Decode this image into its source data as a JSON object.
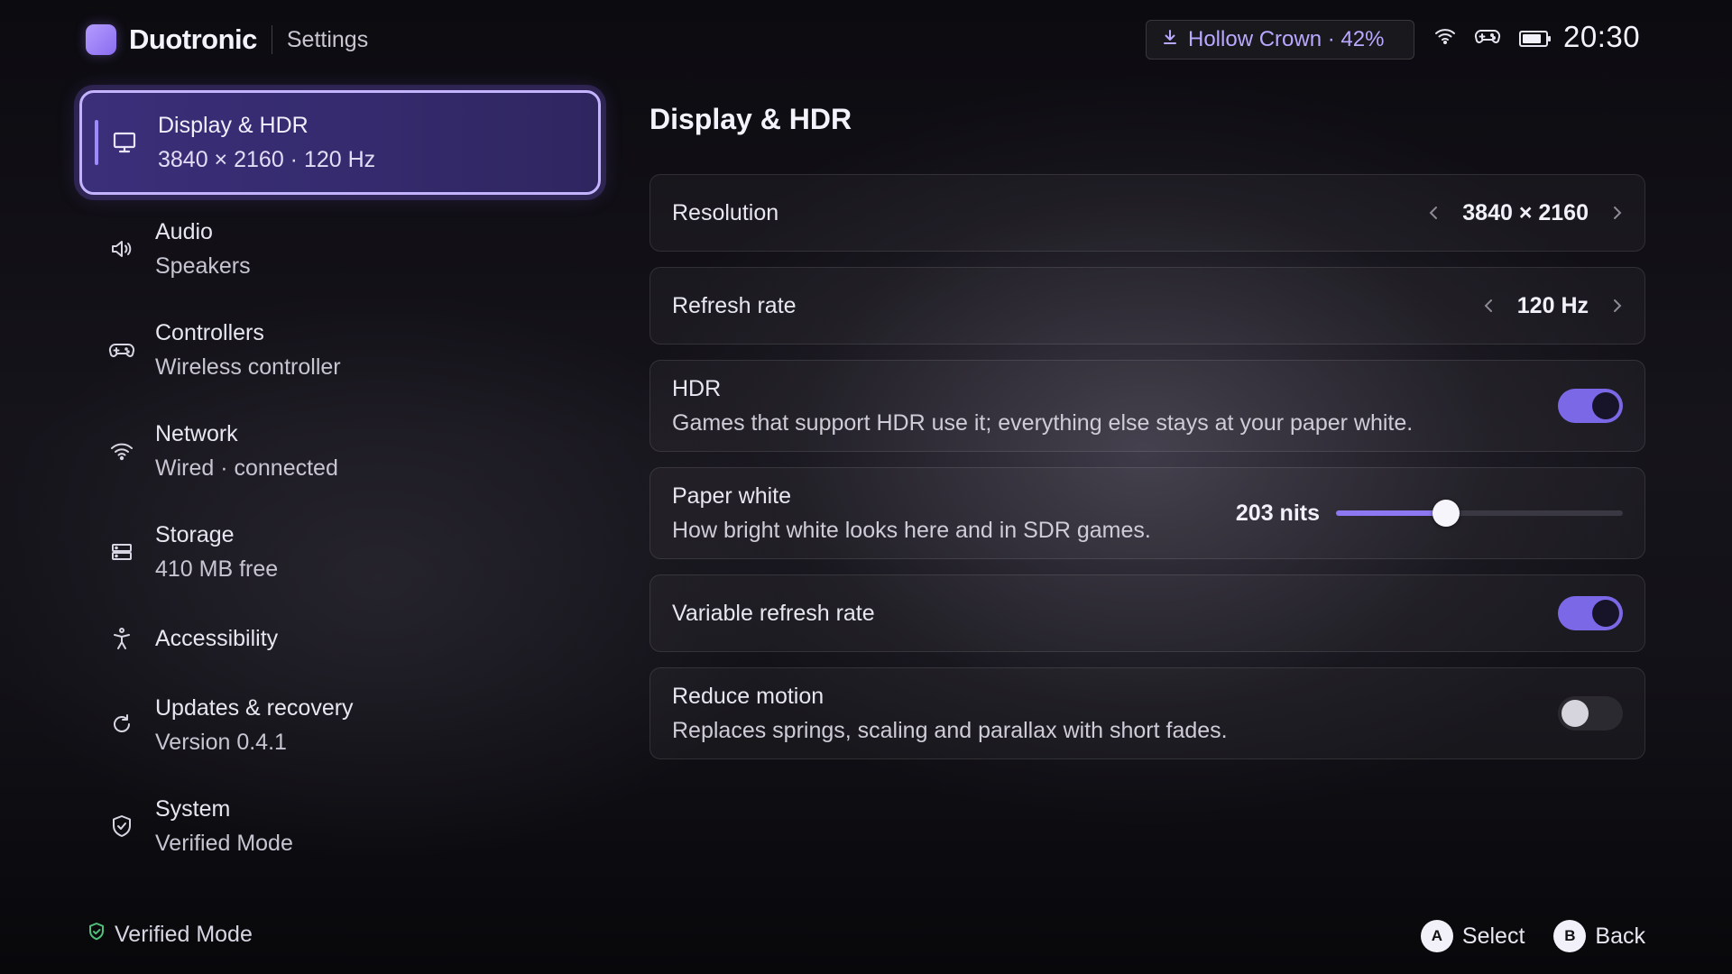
{
  "header": {
    "brand": "Duotronic",
    "section": "Settings",
    "download": "Hollow Crown · 42%",
    "clock": "20:30",
    "battery_level": 0.85
  },
  "sidebar": {
    "items": [
      {
        "title": "Display & HDR",
        "sub": "3840 × 2160 · 120 Hz",
        "icon": "monitor-icon",
        "active": true
      },
      {
        "title": "Audio",
        "sub": "Speakers",
        "icon": "speaker-icon"
      },
      {
        "title": "Controllers",
        "sub": "Wireless controller",
        "icon": "gamepad-icon"
      },
      {
        "title": "Network",
        "sub": "Wired · connected",
        "icon": "wifi-icon"
      },
      {
        "title": "Storage",
        "sub": "410 MB free",
        "icon": "storage-icon"
      },
      {
        "title": "Accessibility",
        "icon": "accessibility-icon"
      },
      {
        "title": "Updates & recovery",
        "sub": "Version 0.4.1",
        "icon": "refresh-icon"
      },
      {
        "title": "System",
        "sub": "Verified Mode",
        "icon": "shield-icon"
      }
    ]
  },
  "main": {
    "title": "Display & HDR",
    "resolution": {
      "label": "Resolution",
      "value": "3840 × 2160"
    },
    "refresh": {
      "label": "Refresh rate",
      "value": "120 Hz"
    },
    "hdr": {
      "label": "HDR",
      "desc": "Games that support HDR use it; everything else stays at your paper white.",
      "on": true
    },
    "paper_white": {
      "label": "Paper white",
      "desc": "How bright white looks here and in SDR games.",
      "value": "203 nits",
      "level": 0.385
    },
    "vrr": {
      "label": "Variable refresh rate",
      "on": true
    },
    "reduce_motion": {
      "label": "Reduce motion",
      "desc": "Replaces springs, scaling and parallax with short fades.",
      "on": false
    }
  },
  "footer": {
    "status": "Verified Mode",
    "hints": [
      {
        "glyph": "A",
        "label": "Select"
      },
      {
        "glyph": "B",
        "label": "Back"
      }
    ]
  },
  "colors": {
    "accent": "#7b68e6",
    "accent_light": "#b9a8ff",
    "verified": "#4fbf7a"
  }
}
